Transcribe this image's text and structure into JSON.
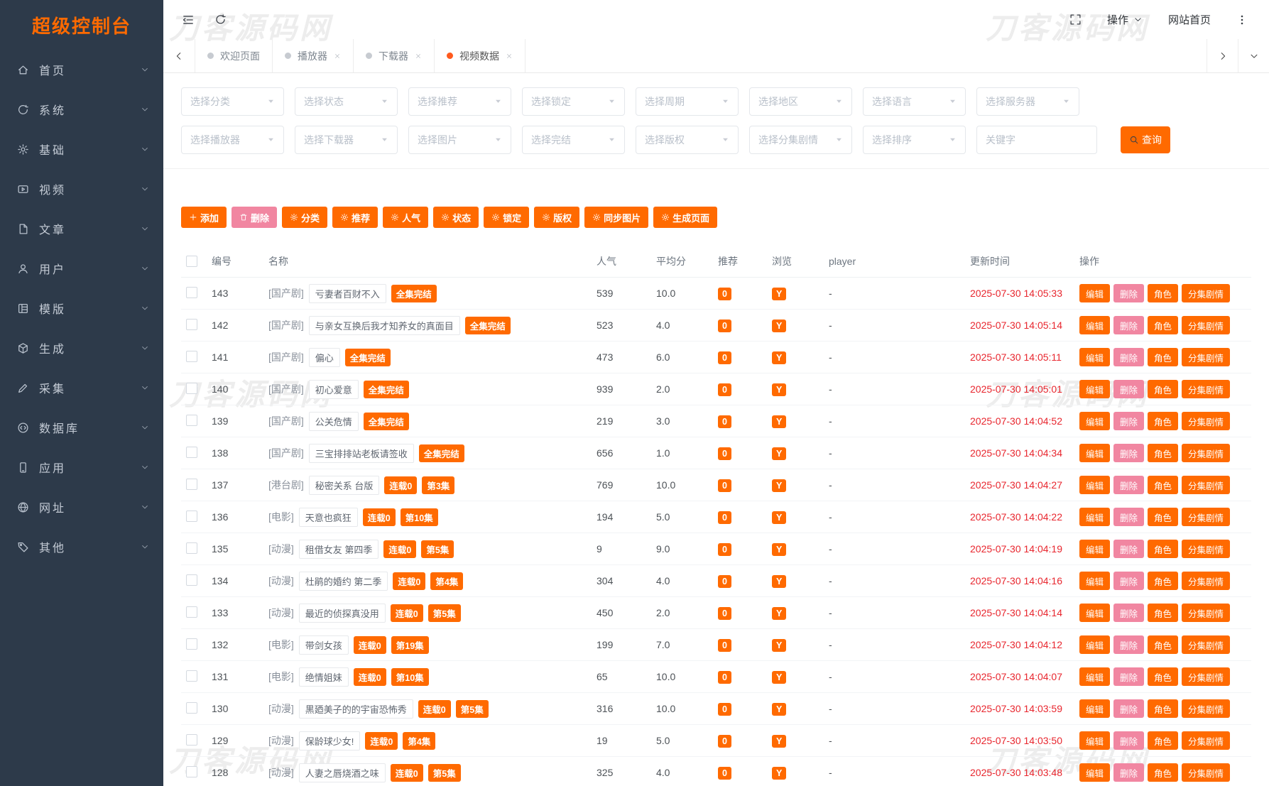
{
  "watermark": "刀客源码网",
  "colors": {
    "accent": "#ff6a00",
    "pink": "#f186a1",
    "time_red": "#e8262e",
    "sidebar_bg": "#2d3a4a",
    "active_dot": "#ff5a1e"
  },
  "sidebar": {
    "title": "超级控制台",
    "items": [
      {
        "key": "home",
        "label": "首页",
        "icon": "home-icon"
      },
      {
        "key": "system",
        "label": "系统",
        "icon": "system-icon"
      },
      {
        "key": "basic",
        "label": "基础",
        "icon": "settings-icon"
      },
      {
        "key": "video",
        "label": "视频",
        "icon": "video-icon"
      },
      {
        "key": "article",
        "label": "文章",
        "icon": "article-icon"
      },
      {
        "key": "user",
        "label": "用户",
        "icon": "user-icon"
      },
      {
        "key": "template",
        "label": "模版",
        "icon": "template-icon"
      },
      {
        "key": "generate",
        "label": "生成",
        "icon": "generate-icon"
      },
      {
        "key": "collect",
        "label": "采集",
        "icon": "collect-icon"
      },
      {
        "key": "database",
        "label": "数据库",
        "icon": "database-icon"
      },
      {
        "key": "app",
        "label": "应用",
        "icon": "app-icon"
      },
      {
        "key": "website",
        "label": "网址",
        "icon": "website-icon"
      },
      {
        "key": "other",
        "label": "其他",
        "icon": "other-icon"
      }
    ]
  },
  "topbar": {
    "action_label": "操作",
    "home_label": "网站首页"
  },
  "tabs": [
    {
      "key": "welcome",
      "label": "欢迎页面",
      "active": false,
      "closable": false
    },
    {
      "key": "player",
      "label": "播放器",
      "active": false,
      "closable": true
    },
    {
      "key": "downloader",
      "label": "下载器",
      "active": false,
      "closable": true
    },
    {
      "key": "video-data",
      "label": "视频数据",
      "active": true,
      "closable": true
    }
  ],
  "filters": {
    "row1": [
      "选择分类",
      "选择状态",
      "选择推荐",
      "选择锁定",
      "选择周期",
      "选择地区",
      "选择语言",
      "选择服务器"
    ],
    "row2": [
      "选择播放器",
      "选择下载器",
      "选择图片",
      "选择完结",
      "选择版权",
      "选择分集剧情",
      "选择排序"
    ],
    "keyword_placeholder": "关键字",
    "search_label": "查询"
  },
  "toolbar": [
    {
      "key": "add",
      "label": "添加",
      "icon": "plus-icon",
      "style": "orange"
    },
    {
      "key": "delete",
      "label": "删除",
      "icon": "trash-icon",
      "style": "pink"
    },
    {
      "key": "category",
      "label": "分类",
      "icon": "gear-icon",
      "style": "orange"
    },
    {
      "key": "recommend",
      "label": "推荐",
      "icon": "gear-icon",
      "style": "orange"
    },
    {
      "key": "popularity",
      "label": "人气",
      "icon": "gear-icon",
      "style": "orange"
    },
    {
      "key": "status",
      "label": "状态",
      "icon": "gear-icon",
      "style": "orange"
    },
    {
      "key": "lock",
      "label": "锁定",
      "icon": "gear-icon",
      "style": "orange"
    },
    {
      "key": "copyright",
      "label": "版权",
      "icon": "gear-icon",
      "style": "orange"
    },
    {
      "key": "sync-images",
      "label": "同步图片",
      "icon": "gear-icon",
      "style": "orange"
    },
    {
      "key": "generate-pages",
      "label": "生成页面",
      "icon": "gear-icon",
      "style": "orange"
    }
  ],
  "table": {
    "headers": [
      "编号",
      "名称",
      "人气",
      "平均分",
      "推荐",
      "浏览",
      "player",
      "更新时间",
      "操作"
    ],
    "row_actions": [
      "编辑",
      "删除",
      "角色",
      "分集剧情"
    ],
    "rows": [
      {
        "id": "143",
        "category": "[国产剧]",
        "title": "亏妻者百财不入",
        "badges": [
          "全集完结"
        ],
        "popularity": "539",
        "score": "10.0",
        "recommend": "0",
        "view": "Y",
        "player": "-",
        "updated": "2025-07-30 14:05:33"
      },
      {
        "id": "142",
        "category": "[国产剧]",
        "title": "与亲女互换后我才知养女的真面目",
        "badges": [
          "全集完结"
        ],
        "popularity": "523",
        "score": "4.0",
        "recommend": "0",
        "view": "Y",
        "player": "-",
        "updated": "2025-07-30 14:05:14"
      },
      {
        "id": "141",
        "category": "[国产剧]",
        "title": "偏心",
        "badges": [
          "全集完结"
        ],
        "popularity": "473",
        "score": "6.0",
        "recommend": "0",
        "view": "Y",
        "player": "-",
        "updated": "2025-07-30 14:05:11"
      },
      {
        "id": "140",
        "category": "[国产剧]",
        "title": "初心爱意",
        "badges": [
          "全集完结"
        ],
        "popularity": "939",
        "score": "2.0",
        "recommend": "0",
        "view": "Y",
        "player": "-",
        "updated": "2025-07-30 14:05:01"
      },
      {
        "id": "139",
        "category": "[国产剧]",
        "title": "公关危情",
        "badges": [
          "全集完结"
        ],
        "popularity": "219",
        "score": "3.0",
        "recommend": "0",
        "view": "Y",
        "player": "-",
        "updated": "2025-07-30 14:04:52"
      },
      {
        "id": "138",
        "category": "[国产剧]",
        "title": "三宝排排站老板请签收",
        "badges": [
          "全集完结"
        ],
        "popularity": "656",
        "score": "1.0",
        "recommend": "0",
        "view": "Y",
        "player": "-",
        "updated": "2025-07-30 14:04:34"
      },
      {
        "id": "137",
        "category": "[港台剧]",
        "title": "秘密关系 台版",
        "badges": [
          "连载0",
          "第3集"
        ],
        "popularity": "769",
        "score": "10.0",
        "recommend": "0",
        "view": "Y",
        "player": "-",
        "updated": "2025-07-30 14:04:27"
      },
      {
        "id": "136",
        "category": "[电影]",
        "title": "天意也疯狂",
        "badges": [
          "连载0",
          "第10集"
        ],
        "popularity": "194",
        "score": "5.0",
        "recommend": "0",
        "view": "Y",
        "player": "-",
        "updated": "2025-07-30 14:04:22"
      },
      {
        "id": "135",
        "category": "[动漫]",
        "title": "租借女友 第四季",
        "badges": [
          "连载0",
          "第5集"
        ],
        "popularity": "9",
        "score": "9.0",
        "recommend": "0",
        "view": "Y",
        "player": "-",
        "updated": "2025-07-30 14:04:19"
      },
      {
        "id": "134",
        "category": "[动漫]",
        "title": "杜鹃的婚约 第二季",
        "badges": [
          "连载0",
          "第4集"
        ],
        "popularity": "304",
        "score": "4.0",
        "recommend": "0",
        "view": "Y",
        "player": "-",
        "updated": "2025-07-30 14:04:16"
      },
      {
        "id": "133",
        "category": "[动漫]",
        "title": "最近的侦探真没用",
        "badges": [
          "连载0",
          "第5集"
        ],
        "popularity": "450",
        "score": "2.0",
        "recommend": "0",
        "view": "Y",
        "player": "-",
        "updated": "2025-07-30 14:04:14"
      },
      {
        "id": "132",
        "category": "[电影]",
        "title": "带剑女孩",
        "badges": [
          "连载0",
          "第19集"
        ],
        "popularity": "199",
        "score": "7.0",
        "recommend": "0",
        "view": "Y",
        "player": "-",
        "updated": "2025-07-30 14:04:12"
      },
      {
        "id": "131",
        "category": "[电影]",
        "title": "绝情姐妹",
        "badges": [
          "连载0",
          "第10集"
        ],
        "popularity": "65",
        "score": "10.0",
        "recommend": "0",
        "view": "Y",
        "player": "-",
        "updated": "2025-07-30 14:04:07"
      },
      {
        "id": "130",
        "category": "[动漫]",
        "title": "黒廼美子的的宇宙恐怖秀",
        "badges": [
          "连载0",
          "第5集"
        ],
        "popularity": "316",
        "score": "10.0",
        "recommend": "0",
        "view": "Y",
        "player": "-",
        "updated": "2025-07-30 14:03:59"
      },
      {
        "id": "129",
        "category": "[动漫]",
        "title": "保龄球少女!",
        "badges": [
          "连载0",
          "第4集"
        ],
        "popularity": "19",
        "score": "5.0",
        "recommend": "0",
        "view": "Y",
        "player": "-",
        "updated": "2025-07-30 14:03:50"
      },
      {
        "id": "128",
        "category": "[动漫]",
        "title": "人妻之唇烧酒之味",
        "badges": [
          "连载0",
          "第5集"
        ],
        "popularity": "325",
        "score": "4.0",
        "recommend": "0",
        "view": "Y",
        "player": "-",
        "updated": "2025-07-30 14:03:48"
      }
    ]
  }
}
